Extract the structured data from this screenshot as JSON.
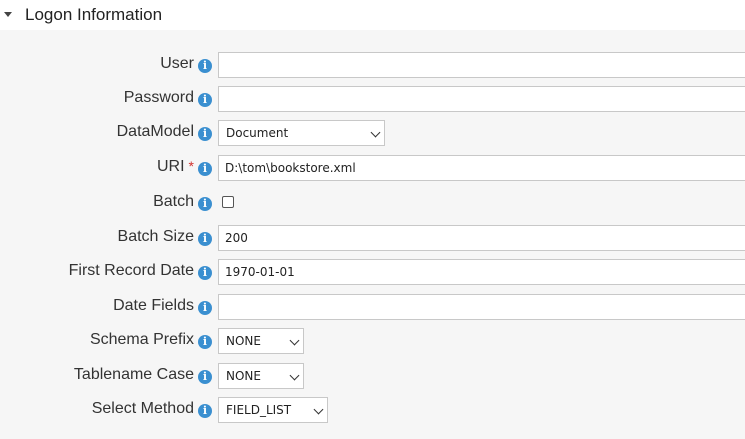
{
  "section": {
    "title": "Logon Information",
    "collapse_icon": "caret-down-icon"
  },
  "fields": {
    "user": {
      "label": "User",
      "value": ""
    },
    "password": {
      "label": "Password",
      "value": ""
    },
    "datamodel": {
      "label": "DataModel",
      "value": "Document"
    },
    "uri": {
      "label": "URI",
      "required_mark": "*",
      "value": "D:\\tom\\bookstore.xml"
    },
    "batch": {
      "label": "Batch",
      "checked": false
    },
    "batch_size": {
      "label": "Batch Size",
      "value": "200"
    },
    "first_record_date": {
      "label": "First Record Date",
      "value": "1970-01-01"
    },
    "date_fields": {
      "label": "Date Fields",
      "value": ""
    },
    "schema_prefix": {
      "label": "Schema Prefix",
      "value": "NONE"
    },
    "tablename_case": {
      "label": "Tablename Case",
      "value": "NONE"
    },
    "select_method": {
      "label": "Select Method",
      "value": "FIELD_LIST"
    }
  },
  "info_icon": {
    "glyph": "i",
    "name": "info-icon",
    "color": "#3a8fd0"
  },
  "colors": {
    "panel_bg": "#f6f6f6",
    "required": "#d0312d"
  }
}
